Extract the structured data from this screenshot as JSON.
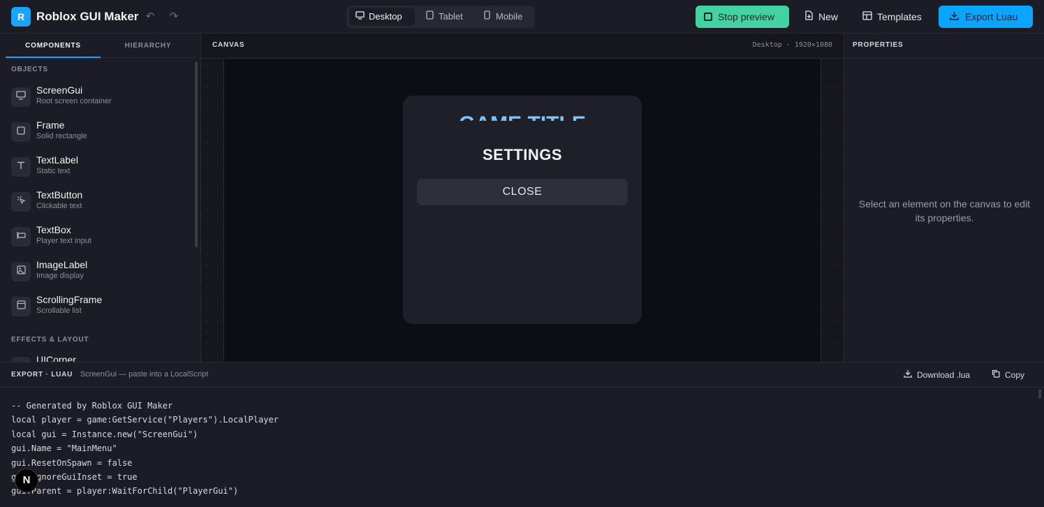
{
  "app": {
    "logo_letter": "R",
    "title": "Roblox GUI Maker",
    "brand_color": "#1aa3ff"
  },
  "toolbar": {
    "undo_icon": "↶",
    "redo_icon": "↷",
    "devices": [
      {
        "label": "Desktop",
        "icon": "monitor-icon",
        "active": true
      },
      {
        "label": "Tablet",
        "icon": "tablet-icon",
        "active": false
      },
      {
        "label": "Mobile",
        "icon": "mobile-icon",
        "active": false
      }
    ],
    "stop_preview": "Stop preview",
    "new": "New",
    "templates": "Templates",
    "export": "Export Luau",
    "stop_color": "#43d3a2",
    "export_color": "#0ba5ff"
  },
  "left": {
    "tabs": [
      "COMPONENTS",
      "HIERARCHY"
    ],
    "sections": {
      "objects": "OBJECTS",
      "effects": "EFFECTS & LAYOUT"
    },
    "components": [
      {
        "name": "ScreenGui",
        "desc": "Root screen container",
        "icon": "monitor-icon"
      },
      {
        "name": "Frame",
        "desc": "Solid rectangle",
        "icon": "square-icon"
      },
      {
        "name": "TextLabel",
        "desc": "Static text",
        "icon": "text-icon"
      },
      {
        "name": "TextButton",
        "desc": "Clickable text",
        "icon": "pointer-icon"
      },
      {
        "name": "TextBox",
        "desc": "Player text input",
        "icon": "textbox-icon"
      },
      {
        "name": "ImageLabel",
        "desc": "Image display",
        "icon": "image-icon"
      },
      {
        "name": "ScrollingFrame",
        "desc": "Scrollable list",
        "icon": "scroll-icon"
      }
    ],
    "effects": [
      {
        "name": "UICorner"
      }
    ]
  },
  "canvas": {
    "title": "CANVAS",
    "info": "Desktop · 1920×1080",
    "frame": {
      "game_title": "GAME TITLE",
      "settings": "SETTINGS",
      "close": "CLOSE"
    }
  },
  "properties": {
    "title": "PROPERTIES",
    "empty": "Select an element on the canvas to edit its properties."
  },
  "export_panel": {
    "title": "EXPORT · LUAU",
    "subtitle": "ScreenGui — paste into a LocalScript",
    "download": "Download .lua",
    "copy": "Copy",
    "code": "-- Generated by Roblox GUI Maker\nlocal player = game:GetService(\"Players\").LocalPlayer\nlocal gui = Instance.new(\"ScreenGui\")\ngui.Name = \"MainMenu\"\ngui.ResetOnSpawn = false\ngui.IgnoreGuiInset = true\ngui.Parent = player:WaitForChild(\"PlayerGui\")"
  },
  "overlay": {
    "badge": "N"
  }
}
